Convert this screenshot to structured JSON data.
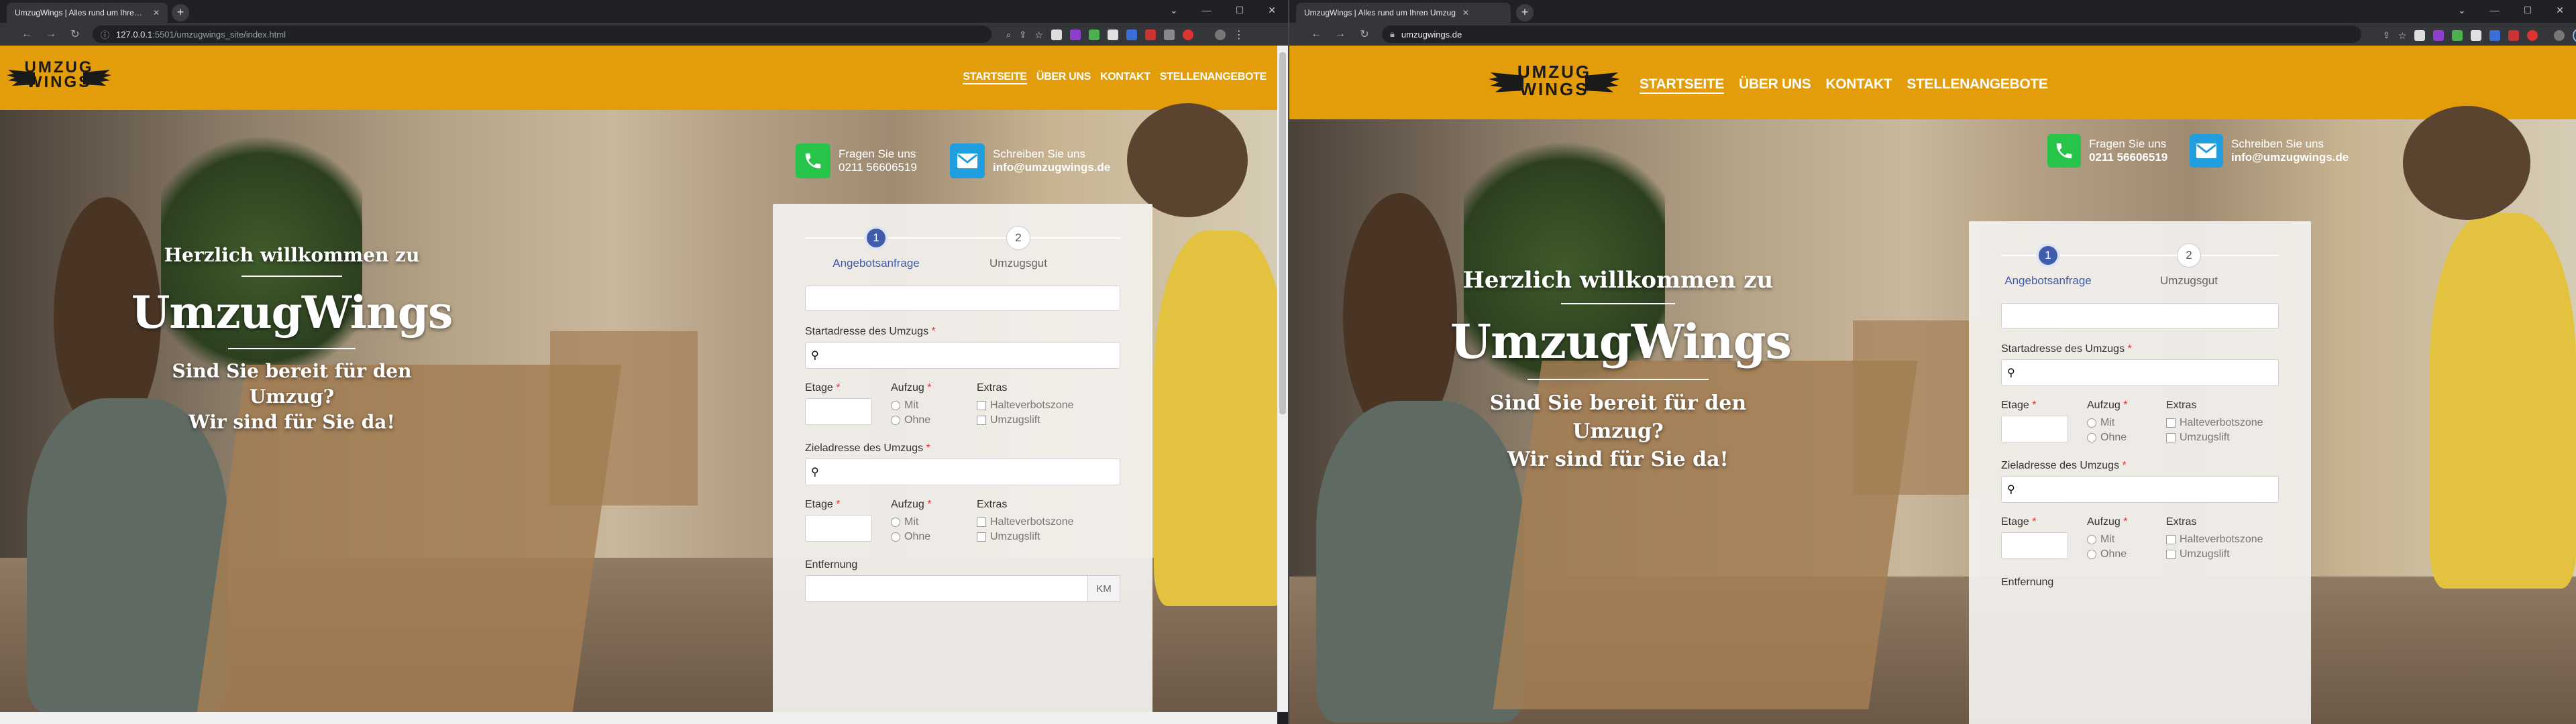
{
  "left_window": {
    "tab": {
      "title": "UmzugWings | Alles rund um Ihren Umzug"
    },
    "address": {
      "host": "127.0.0.1",
      "path": ":5501/umzugwings_site/index.html"
    }
  },
  "right_window": {
    "tab": {
      "title": "UmzugWings | Alles rund um Ihren Umzug"
    },
    "address": {
      "host": "umzugwings.de",
      "path": ""
    }
  },
  "site": {
    "logo_line1": "UMZUG",
    "logo_line2": "WINGS",
    "nav": [
      "STARTSEITE",
      "ÜBER UNS",
      "KONTAKT",
      "STELLENANGEBOTE"
    ],
    "contact_phone_label": "Fragen Sie uns",
    "contact_phone_value": "0211 56606519",
    "contact_mail_label": "Schreiben Sie uns",
    "contact_mail_value": "info@umzugwings.de",
    "welcome_small": "Herzlich willkommen zu",
    "welcome_big": "UmzugWings",
    "welcome_sub1": "Sind Sie bereit für den Umzug?",
    "welcome_sub2": "Wir sind für Sie da!"
  },
  "form": {
    "step1_num": "1",
    "step1_label": "Angebotsanfrage",
    "step2_num": "2",
    "step2_label": "Umzugsgut",
    "start_label": "Startadresse des Umzugs",
    "ziel_label": "Zieladresse des Umzugs",
    "etage_label": "Etage",
    "aufzug_label": "Aufzug",
    "extras_label": "Extras",
    "opt_mit": "Mit",
    "opt_ohne": "Ohne",
    "extra_halteverbot": "Halteverbotszone",
    "extra_lift": "Umzugslift",
    "entfernung_label": "Entfernung",
    "km": "KM",
    "required_mark": "*"
  },
  "colors": {
    "brand": "#e39d0a",
    "accent": "#3f5dab",
    "phone_icon": "#26c54a",
    "mail_icon": "#1f9ee0"
  }
}
